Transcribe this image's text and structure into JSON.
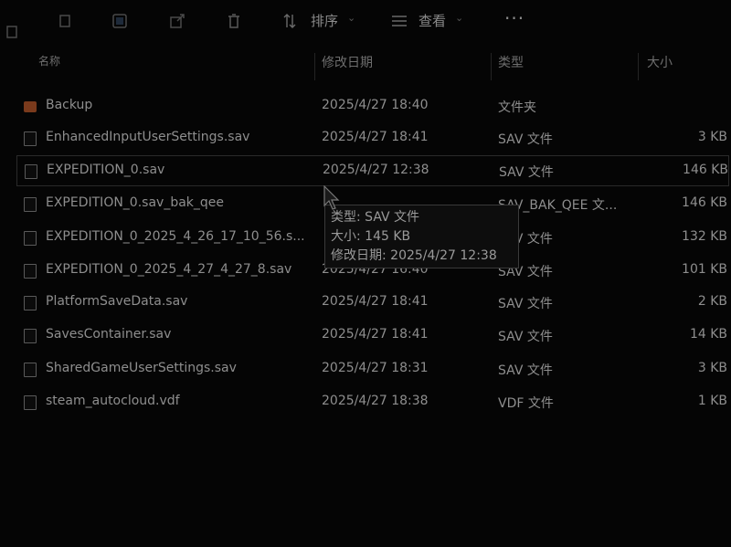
{
  "toolbar": {
    "sort_label": "排序",
    "view_label": "查看",
    "more_label": "···"
  },
  "columns": {
    "name": "名称",
    "date": "修改日期",
    "type": "类型",
    "size": "大小"
  },
  "files": [
    {
      "name": "Backup",
      "date": "2025/4/27 18:40",
      "type": "文件夹",
      "size": "",
      "kind": "folder"
    },
    {
      "name": "EnhancedInputUserSettings.sav",
      "date": "2025/4/27 18:41",
      "type": "SAV 文件",
      "size": "3 KB",
      "kind": "file"
    },
    {
      "name": "EXPEDITION_0.sav",
      "date": "2025/4/27 12:38",
      "type": "SAV 文件",
      "size": "146 KB",
      "kind": "file"
    },
    {
      "name": "EXPEDITION_0.sav_bak_qee",
      "date": "",
      "type": "SAV_BAK_QEE 文...",
      "size": "146 KB",
      "kind": "file"
    },
    {
      "name": "EXPEDITION_0_2025_4_26_17_10_56.s...",
      "date": "",
      "type": "SAV 文件",
      "size": "132 KB",
      "kind": "file"
    },
    {
      "name": "EXPEDITION_0_2025_4_27_4_27_8.sav",
      "date": "2025/4/27 16:40",
      "type": "SAV 文件",
      "size": "101 KB",
      "kind": "file"
    },
    {
      "name": "PlatformSaveData.sav",
      "date": "2025/4/27 18:41",
      "type": "SAV 文件",
      "size": "2 KB",
      "kind": "file"
    },
    {
      "name": "SavesContainer.sav",
      "date": "2025/4/27 18:41",
      "type": "SAV 文件",
      "size": "14 KB",
      "kind": "file"
    },
    {
      "name": "SharedGameUserSettings.sav",
      "date": "2025/4/27 18:31",
      "type": "SAV 文件",
      "size": "3 KB",
      "kind": "file"
    },
    {
      "name": "steam_autocloud.vdf",
      "date": "2025/4/27 18:38",
      "type": "VDF 文件",
      "size": "1 KB",
      "kind": "file"
    }
  ],
  "tooltip": {
    "type_line": "类型: SAV 文件",
    "size_line": "大小: 145 KB",
    "date_line": "修改日期: 2025/4/27 12:38"
  },
  "colors": {
    "background": "#050505",
    "folder": "#7a3a1c",
    "text": "#8e8e8e"
  }
}
